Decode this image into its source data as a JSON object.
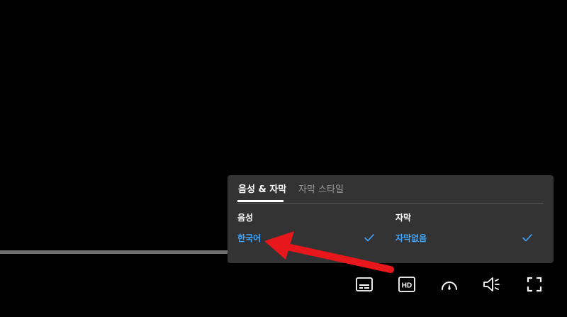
{
  "player": {
    "progress_fraction": 0.41
  },
  "settings_panel": {
    "tabs": [
      {
        "label": "음성 & 자막",
        "active": true
      },
      {
        "label": "자막 스타일",
        "active": false
      }
    ],
    "audio": {
      "heading": "음성",
      "selected_option": "한국어"
    },
    "subtitles": {
      "heading": "자막",
      "selected_option": "자막없음"
    }
  },
  "controls": {
    "hd_label": "HD",
    "icons": [
      "subtitles-icon",
      "hd-icon",
      "speed-gauge-icon",
      "volume-icon",
      "fullscreen-icon"
    ]
  },
  "colors": {
    "background": "#000000",
    "panel": "#333333",
    "accent": "#3ea6ff",
    "annotation": "#e8171b"
  }
}
